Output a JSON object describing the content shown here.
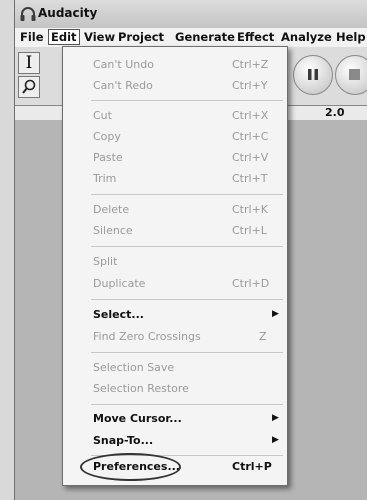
{
  "app": {
    "title": "Audacity"
  },
  "menubar": {
    "items": [
      "File",
      "Edit",
      "View",
      "Project",
      "Generate",
      "Effect",
      "Analyze",
      "Help"
    ]
  },
  "ruler": {
    "label": "2.0"
  },
  "edit_menu": {
    "undo": {
      "label": "Can't Undo",
      "shortcut": "Ctrl+Z"
    },
    "redo": {
      "label": "Can't Redo",
      "shortcut": "Ctrl+Y"
    },
    "cut": {
      "label": "Cut",
      "shortcut": "Ctrl+X"
    },
    "copy": {
      "label": "Copy",
      "shortcut": "Ctrl+C"
    },
    "paste": {
      "label": "Paste",
      "shortcut": "Ctrl+V"
    },
    "trim": {
      "label": "Trim",
      "shortcut": "Ctrl+T"
    },
    "delete": {
      "label": "Delete",
      "shortcut": "Ctrl+K"
    },
    "silence": {
      "label": "Silence",
      "shortcut": "Ctrl+L"
    },
    "split": {
      "label": "Split",
      "shortcut": ""
    },
    "duplicate": {
      "label": "Duplicate",
      "shortcut": "Ctrl+D"
    },
    "select": {
      "label": "Select..."
    },
    "find_zero": {
      "label": "Find Zero Crossings",
      "shortcut": "Z"
    },
    "selection_save": {
      "label": "Selection Save"
    },
    "selection_restore": {
      "label": "Selection Restore"
    },
    "move_cursor": {
      "label": "Move Cursor..."
    },
    "snap_to": {
      "label": "Snap-To..."
    },
    "preferences": {
      "label": "Preferences...",
      "shortcut": "Ctrl+P"
    }
  }
}
